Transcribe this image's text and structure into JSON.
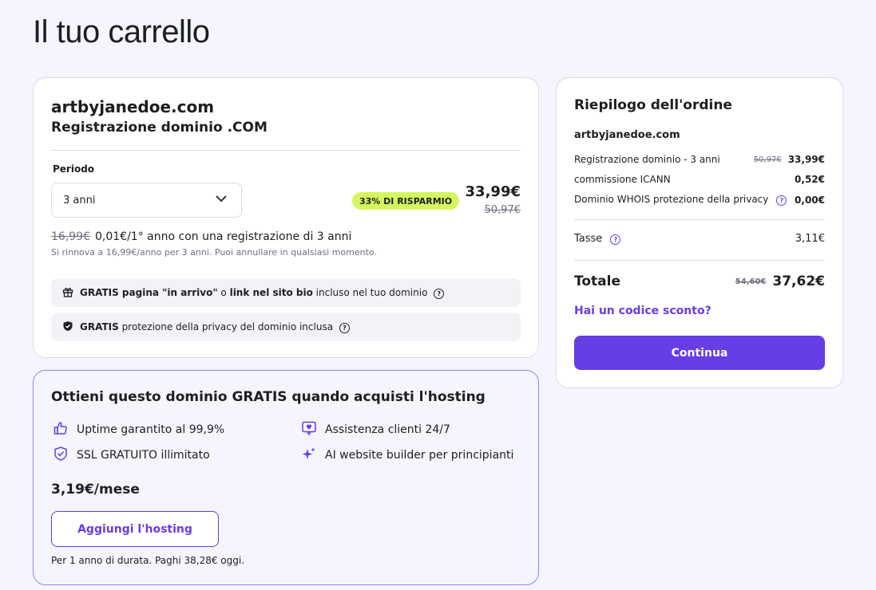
{
  "page": {
    "title": "Il tuo carrello"
  },
  "domain_card": {
    "domain": "artbyjanedoe.com",
    "product": "Registrazione dominio .COM",
    "period_label": "Periodo",
    "period_value": "3 anni",
    "badge": "33% DI RISPARMIO",
    "price": "33,99€",
    "price_old": "50,97€",
    "promo_old": "16,99€",
    "promo_text": "0,01€/1° anno con una registrazione di 3 anni",
    "renew_text": "Si rinnova a 16,99€/anno per 3 anni. Puoi annullare in qualsiasi momento.",
    "perk1": {
      "b1": "GRATIS",
      "t1": " pagina \"in arrivo\"",
      "t2": " o ",
      "b2": "link nel sito bio",
      "t3": " incluso nel tuo dominio"
    },
    "perk2": {
      "b1": "GRATIS",
      "t1": " protezione della privacy del dominio inclusa"
    }
  },
  "summary": {
    "title": "Riepilogo dell'ordine",
    "domain": "artbyjanedoe.com",
    "rows": [
      {
        "label": "Registrazione dominio - 3 anni",
        "old": "50,97€",
        "value": "33,99€"
      },
      {
        "label": "commissione ICANN",
        "old": "",
        "value": "0,52€"
      },
      {
        "label": "Dominio WHOIS protezione della privacy",
        "old": "",
        "value": "0,00€"
      }
    ],
    "tax_label": "Tasse",
    "tax_value": "3,11€",
    "total_label": "Totale",
    "total_old": "54,60€",
    "total_value": "37,62€",
    "coupon": "Hai un codice sconto?",
    "continue": "Continua"
  },
  "hosting": {
    "title": "Ottieni questo dominio GRATIS quando acquisti l'hosting",
    "features": [
      "Uptime garantito al 99,9%",
      "Assistenza clienti 24/7",
      "SSL GRATUITO illimitato",
      "AI website builder per principianti"
    ],
    "price": "3,19€/mese",
    "button": "Aggiungi l'hosting",
    "note": "Per 1 anno di durata. Paghi 38,28€ oggi."
  },
  "colors": {
    "accent": "#673de6",
    "badge": "#d5f65e",
    "background": "#f4f5ff"
  }
}
